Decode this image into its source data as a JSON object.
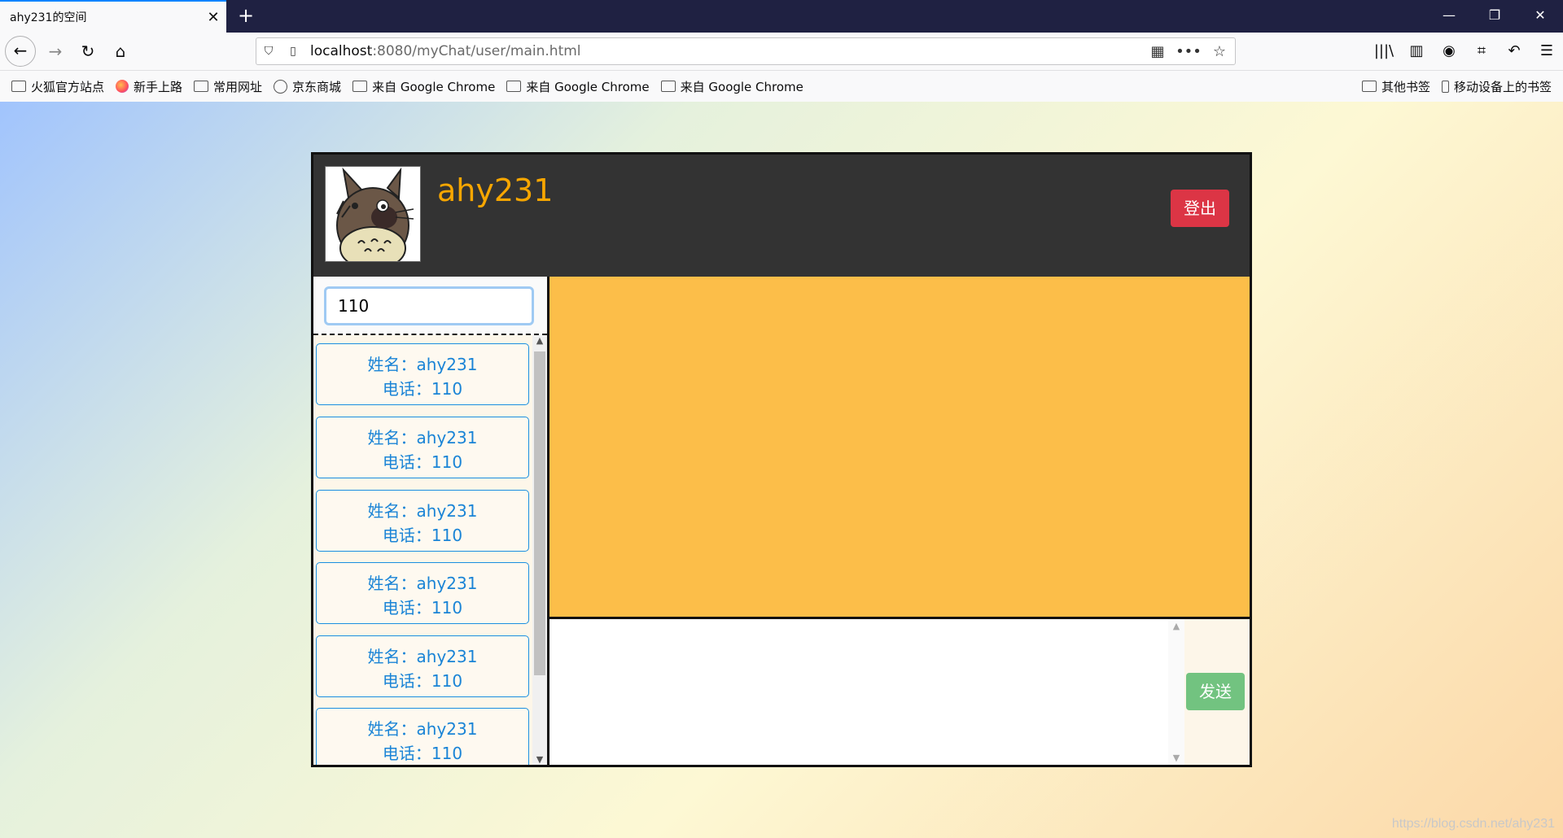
{
  "browser": {
    "tab_title": "ahy231的空间",
    "tab_close": "✕",
    "new_tab": "+",
    "url_host": "localhost",
    "url_path": ":8080/myChat/user/main.html",
    "window_controls": [
      "—",
      "❐",
      "✕"
    ],
    "bookmarks": [
      {
        "label": "火狐官方站点",
        "icon": "folder-icon"
      },
      {
        "label": "新手上路",
        "icon": "firefox-icon"
      },
      {
        "label": "常用网址",
        "icon": "folder-icon"
      },
      {
        "label": "京东商城",
        "icon": "globe-icon"
      },
      {
        "label": "来自 Google Chrome",
        "icon": "folder-icon"
      },
      {
        "label": "来自 Google Chrome",
        "icon": "folder-icon"
      },
      {
        "label": "来自 Google Chrome",
        "icon": "folder-icon"
      }
    ],
    "bookmarks_right": [
      {
        "label": "其他书签",
        "icon": "folder-icon"
      },
      {
        "label": "移动设备上的书签",
        "icon": "mobile-icon"
      }
    ]
  },
  "app": {
    "username": "ahy231",
    "logout_label": "登出",
    "search_value": "110",
    "send_label": "发送",
    "contacts": [
      {
        "name": "姓名：ahy231",
        "phone": "电话：110"
      },
      {
        "name": "姓名：ahy231",
        "phone": "电话：110"
      },
      {
        "name": "姓名：ahy231",
        "phone": "电话：110"
      },
      {
        "name": "姓名：ahy231",
        "phone": "电话：110"
      },
      {
        "name": "姓名：ahy231",
        "phone": "电话：110"
      },
      {
        "name": "姓名：ahy231",
        "phone": "电话：110"
      }
    ]
  },
  "watermark": "https://blog.csdn.net/ahy231",
  "colors": {
    "header_bg": "#333333",
    "username": "#f7a600",
    "logout": "#dc3545",
    "chat_bg": "#fcbe49",
    "send": "#72c380",
    "contact_text": "#1a84d6"
  }
}
